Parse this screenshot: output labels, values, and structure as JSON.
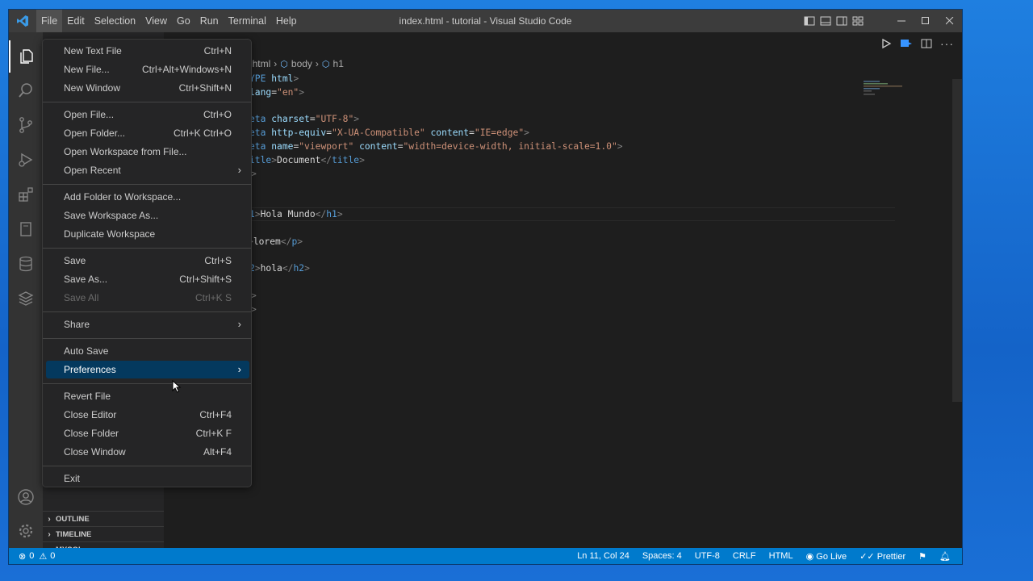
{
  "window": {
    "title": "index.html - tutorial - Visual Studio Code"
  },
  "menubar": [
    "File",
    "Edit",
    "Selection",
    "View",
    "Go",
    "Run",
    "Terminal",
    "Help"
  ],
  "file_menu": {
    "groups": [
      [
        {
          "label": "New Text File",
          "key": "Ctrl+N"
        },
        {
          "label": "New File...",
          "key": "Ctrl+Alt+Windows+N"
        },
        {
          "label": "New Window",
          "key": "Ctrl+Shift+N"
        }
      ],
      [
        {
          "label": "Open File...",
          "key": "Ctrl+O"
        },
        {
          "label": "Open Folder...",
          "key": "Ctrl+K Ctrl+O"
        },
        {
          "label": "Open Workspace from File...",
          "key": ""
        },
        {
          "label": "Open Recent",
          "key": "",
          "submenu": true
        }
      ],
      [
        {
          "label": "Add Folder to Workspace...",
          "key": ""
        },
        {
          "label": "Save Workspace As...",
          "key": ""
        },
        {
          "label": "Duplicate Workspace",
          "key": ""
        }
      ],
      [
        {
          "label": "Save",
          "key": "Ctrl+S"
        },
        {
          "label": "Save As...",
          "key": "Ctrl+Shift+S"
        },
        {
          "label": "Save All",
          "key": "Ctrl+K S",
          "disabled": true
        }
      ],
      [
        {
          "label": "Share",
          "key": "",
          "submenu": true
        }
      ],
      [
        {
          "label": "Auto Save",
          "key": ""
        },
        {
          "label": "Preferences",
          "key": "",
          "submenu": true,
          "selected": true
        }
      ],
      [
        {
          "label": "Revert File",
          "key": ""
        },
        {
          "label": "Close Editor",
          "key": "Ctrl+F4"
        },
        {
          "label": "Close Folder",
          "key": "Ctrl+K F"
        },
        {
          "label": "Close Window",
          "key": "Alt+F4"
        }
      ],
      [
        {
          "label": "Exit",
          "key": ""
        }
      ]
    ]
  },
  "breadcrumb": [
    "html",
    "body",
    "h1"
  ],
  "code_lines": [
    [
      [
        "tk-tag",
        "YPE "
      ],
      [
        "tk-attr",
        "html"
      ],
      [
        "tk-brk",
        ">"
      ]
    ],
    [
      [
        "tk-attr",
        "lang"
      ],
      [
        "tk-txt",
        "="
      ],
      [
        "tk-str",
        "\"en\""
      ],
      [
        "tk-brk",
        ">"
      ]
    ],
    [],
    [
      [
        "tk-tag",
        "eta "
      ],
      [
        "tk-attr",
        "charset"
      ],
      [
        "tk-txt",
        "="
      ],
      [
        "tk-str",
        "\"UTF-8\""
      ],
      [
        "tk-brk",
        ">"
      ]
    ],
    [
      [
        "tk-tag",
        "eta "
      ],
      [
        "tk-attr",
        "http-equiv"
      ],
      [
        "tk-txt",
        "="
      ],
      [
        "tk-str",
        "\"X-UA-Compatible\""
      ],
      [
        "tk-txt",
        " "
      ],
      [
        "tk-attr",
        "content"
      ],
      [
        "tk-txt",
        "="
      ],
      [
        "tk-str",
        "\"IE=edge\""
      ],
      [
        "tk-brk",
        ">"
      ]
    ],
    [
      [
        "tk-tag",
        "eta "
      ],
      [
        "tk-attr",
        "name"
      ],
      [
        "tk-txt",
        "="
      ],
      [
        "tk-str",
        "\"viewport\""
      ],
      [
        "tk-txt",
        " "
      ],
      [
        "tk-attr",
        "content"
      ],
      [
        "tk-txt",
        "="
      ],
      [
        "tk-str",
        "\"width=device-width, initial-scale=1.0\""
      ],
      [
        "tk-brk",
        ">"
      ]
    ],
    [
      [
        "tk-tag",
        "itle"
      ],
      [
        "tk-brk",
        ">"
      ],
      [
        "tk-txt",
        "Document"
      ],
      [
        "tk-brk",
        "</"
      ],
      [
        "tk-tag",
        "title"
      ],
      [
        "tk-brk",
        ">"
      ]
    ],
    [
      [
        "tk-brk",
        ">"
      ]
    ],
    [],
    [],
    [
      [
        "tk-tag",
        "1"
      ],
      [
        "tk-brk",
        ">"
      ],
      [
        "tk-txt",
        "Hola Mundo"
      ],
      [
        "tk-brk",
        "</"
      ],
      [
        "tk-tag",
        "h1"
      ],
      [
        "tk-brk",
        ">"
      ]
    ],
    [],
    [
      [
        "tk-brk",
        ">"
      ],
      [
        "tk-txt",
        "lorem"
      ],
      [
        "tk-brk",
        "</"
      ],
      [
        "tk-tag",
        "p"
      ],
      [
        "tk-brk",
        ">"
      ]
    ],
    [],
    [
      [
        "tk-tag",
        "2"
      ],
      [
        "tk-brk",
        ">"
      ],
      [
        "tk-txt",
        "hola"
      ],
      [
        "tk-brk",
        "</"
      ],
      [
        "tk-tag",
        "h2"
      ],
      [
        "tk-brk",
        ">"
      ]
    ],
    [],
    [
      [
        "tk-brk",
        ">"
      ]
    ],
    [
      [
        "tk-brk",
        ">"
      ]
    ]
  ],
  "sidebar_sections": [
    "OUTLINE",
    "TIMELINE",
    "MYSQL"
  ],
  "status": {
    "errors": "0",
    "warnings": "0",
    "position": "Ln 11, Col 24",
    "spaces": "Spaces: 4",
    "encoding": "UTF-8",
    "eol": "CRLF",
    "language": "HTML",
    "golive": "Go Live",
    "prettier": "Prettier"
  },
  "colors": {
    "accent": "#007acc",
    "selection": "#04395e",
    "desktop": "#1a6fd6"
  }
}
